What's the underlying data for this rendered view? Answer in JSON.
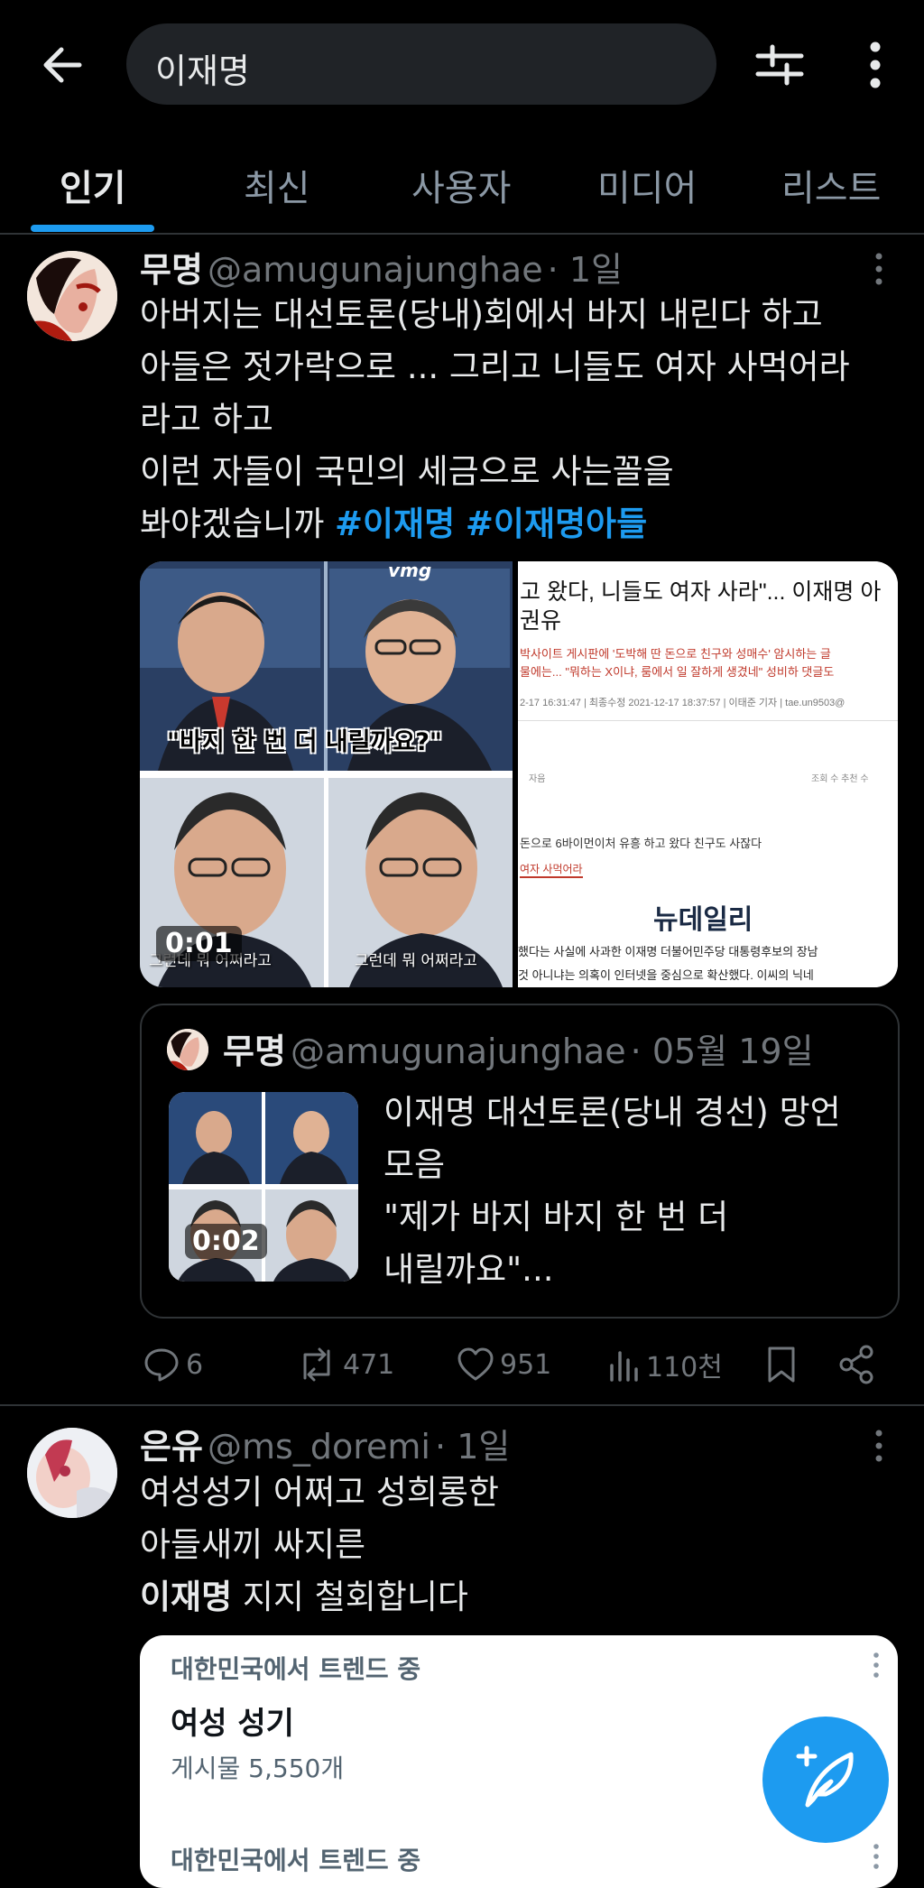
{
  "search": {
    "query": "이재명"
  },
  "tabs": [
    "인기",
    "최신",
    "사용자",
    "미디어",
    "리스트"
  ],
  "post1": {
    "name": "무명",
    "handle": "@amugunajunghae",
    "time": "· 1일",
    "lines": [
      "아버지는 대선토론(당내)회에서 바지 내린다 하고",
      "아들은 젓가락으로 ... 그리고 니들도 여자 사먹어라",
      "라고 하고",
      "이런 자들이 국민의 세금으로 사는꼴을",
      "봐야겠습니까"
    ],
    "hashtags": [
      "#이재명",
      "#이재명아들"
    ],
    "media": {
      "video_caption": "\"바지 한 번 더 내릴까요?\"",
      "video_sub_left": "그런데 뭐 어쩌라고",
      "video_sub_right": "그런데 뭐 어쩌라고",
      "video_duration": "0:01",
      "video_logo": "vmg",
      "article_headline_1": "고 왔다, 니들도 여자 사라\"... 이재명 아",
      "article_headline_2": "권유",
      "article_red_1": "박사이트 게시판에 '도박해 딴 돈으로 친구와 성매수' 암시하는 글",
      "article_red_2": "물에는... \"뭐하는 X이냐, 룸에서 일 잘하게 생겼네\" 성비하 댓글도",
      "article_meta": "2-17 16:31:47 | 최종수정 2021-12-17 18:37:57 | 이태준 기자 | tae.un9503@",
      "article_table_head": "자음",
      "article_table_cols": "조회 수  추천 수",
      "article_line_1": "돈으로 6바이먼이처 유흥 하고 왔다 친구도 사잖다",
      "article_line_2": "여자 사먹어라",
      "article_logo": "뉴데일리",
      "article_bottom_1": "했다는 사실에 사과한 이재명 더불어민주당 대통령후보의 장남",
      "article_bottom_2": "것 아니냐는 의혹이 인터넷을 중심으로 확산했다. 이씨의 닉네"
    },
    "quote": {
      "name": "무명",
      "handle": "@amugunajunghae",
      "date": "· 05월 19일",
      "thumb_duration": "0:02",
      "lines": [
        "이재명 대선토론(당내 경선) 망언",
        "모음",
        "\"제가 바지 바지 한 번 더",
        "내릴까요\"..."
      ]
    },
    "actions": {
      "replies": "6",
      "reposts": "471",
      "likes": "951",
      "views": "110천"
    }
  },
  "post2": {
    "name": "은유",
    "handle": "@ms_doremi",
    "time": "· 1일",
    "lines": [
      "여성성기 어쩌고 성희롱한",
      "아들새끼 싸지른"
    ],
    "line3_bold": "이재명",
    "line3_rest": " 지지 철회합니다",
    "trend": {
      "label": "대한민국에서 트렌드 중",
      "title": "여성 성기",
      "count": "게시물 5,550개",
      "label2": "대한민국에서 트렌드 중"
    }
  },
  "colors": {
    "accent": "#1d9bf0",
    "background": "#000000",
    "secondary_text": "#71767b"
  }
}
